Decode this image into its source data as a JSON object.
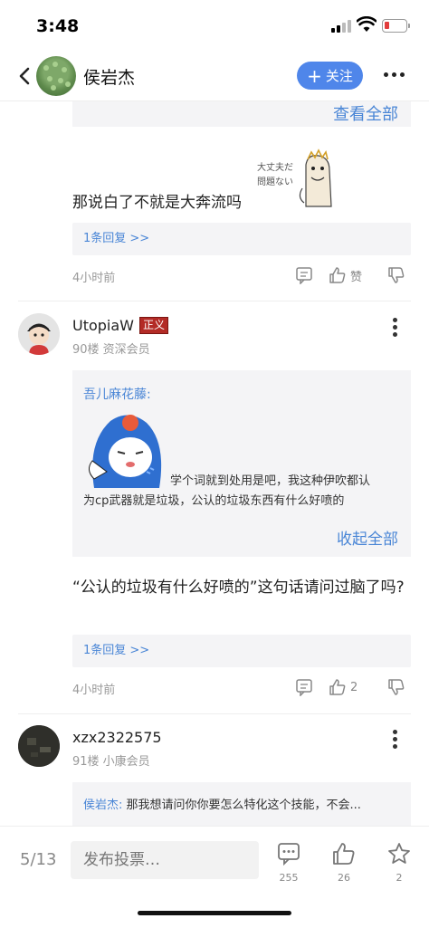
{
  "status_bar": {
    "time": "3:48"
  },
  "nav": {
    "title": "侯岩杰",
    "follow_label": "关注"
  },
  "top_section": {
    "see_all": "查看全部",
    "sticker_text": "大丈夫だ問題ない",
    "reply_text": "那说白了不就是大奔流吗",
    "reply_count": "1条回复 >>",
    "time": "4小时前",
    "like_label": "赞"
  },
  "post_90": {
    "username": "UtopiaW",
    "badge": "正义",
    "meta": "90楼 资深会员",
    "quote_author": "吾儿麻花藤:",
    "quote_text_line1": "学个词就到处用是吧，我这种伊吹都认",
    "quote_text_line2": "为cp武器就是垃圾，公认的垃圾东西有什么好喷的",
    "collapse": "收起全部",
    "reply_text": "“公认的垃圾有什么好喷的”这句话请问过脑了吗?",
    "reply_count": "1条回复 >>",
    "time": "4小时前",
    "like_count": "2"
  },
  "post_91": {
    "username": "xzx2322575",
    "meta": "91楼 小康会员",
    "quote_author": "侯岩杰:",
    "quote_text": "那我想请问你你要怎么特化这个技能，不会..."
  },
  "bottom_bar": {
    "page_indicator": "5/13",
    "input_placeholder": "发布投票…",
    "comment_count": "255",
    "like_count": "26",
    "favorite_count": "2"
  },
  "colors": {
    "accent": "#4f86ea",
    "link": "#4a86d6",
    "badge": "#b32b26"
  }
}
